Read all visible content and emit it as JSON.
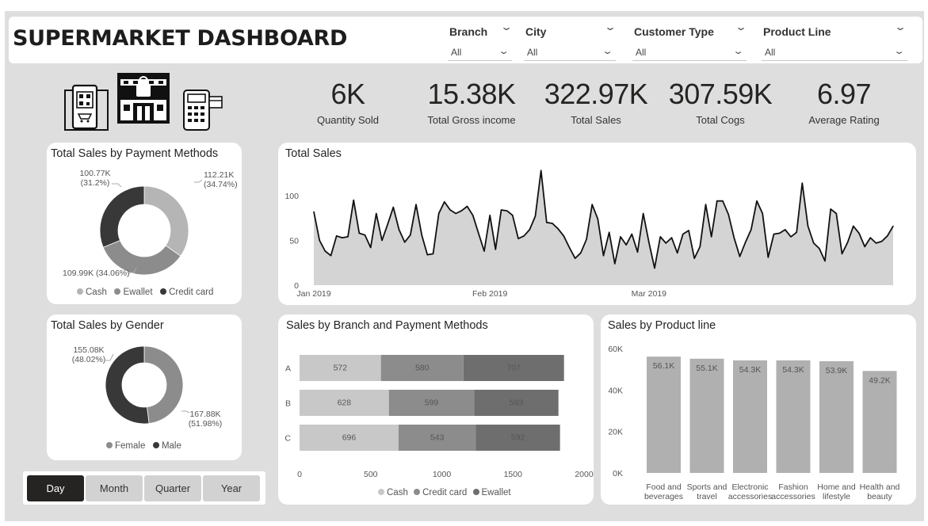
{
  "header": {
    "title": "SUPERMARKET DASHBOARD"
  },
  "filters": [
    {
      "label": "Branch",
      "value": "All"
    },
    {
      "label": "City",
      "value": "All"
    },
    {
      "label": "Customer Type",
      "value": "All"
    },
    {
      "label": "Product Line",
      "value": "All"
    }
  ],
  "kpis": [
    {
      "value": "6K",
      "label": "Quantity Sold"
    },
    {
      "value": "15.38K",
      "label": "Total Gross income"
    },
    {
      "value": "322.97K",
      "label": "Total Sales"
    },
    {
      "value": "307.59K",
      "label": "Total Cogs"
    },
    {
      "value": "6.97",
      "label": "Average Rating"
    }
  ],
  "icons": [
    "phone-qr-icon",
    "store-icon",
    "card-terminal-icon"
  ],
  "colors": {
    "light": "#b5b5b5",
    "mid": "#8c8c8c",
    "dark": "#383838",
    "area": "#d4d4d4"
  },
  "time_buttons": {
    "active": "Day",
    "items": [
      "Day",
      "Month",
      "Quarter",
      "Year"
    ]
  },
  "chart_data": [
    {
      "type": "pie",
      "title": "Total Sales by Payment Methods",
      "categories": [
        "Cash",
        "Ewallet",
        "Credit card"
      ],
      "values": [
        112.21,
        109.99,
        100.77
      ],
      "labels": [
        [
          "112.21K",
          "(34.74%)"
        ],
        [
          "109.99K (34.06%)"
        ],
        [
          "100.77K",
          "(31.2%)"
        ]
      ],
      "colors": [
        "#b5b5b5",
        "#8c8c8c",
        "#383838"
      ],
      "legend": "bottom"
    },
    {
      "type": "pie",
      "title": "Total Sales by Gender",
      "categories": [
        "Female",
        "Male"
      ],
      "values": [
        155.08,
        167.88
      ],
      "labels": [
        [
          "155.08K",
          "(48.02%)"
        ],
        [
          "167.88K",
          "(51.98%)"
        ]
      ],
      "colors": [
        "#8c8c8c",
        "#383838"
      ],
      "legend": "bottom"
    },
    {
      "type": "area",
      "title": "Total Sales",
      "x_ticks": [
        "Jan 2019",
        "Feb 2019",
        "Mar 2019"
      ],
      "y_ticks": [
        "0",
        "50",
        "100"
      ],
      "ylim": [
        0,
        130
      ],
      "x_start": "2019-01-01",
      "values": [
        82,
        50,
        38,
        33,
        55,
        53,
        54,
        95,
        58,
        56,
        42,
        80,
        50,
        68,
        87,
        62,
        48,
        56,
        90,
        56,
        34,
        35,
        80,
        93,
        84,
        80,
        83,
        88,
        78,
        58,
        38,
        78,
        40,
        84,
        83,
        78,
        52,
        55,
        62,
        77,
        128,
        70,
        69,
        63,
        55,
        42,
        30,
        36,
        51,
        90,
        74,
        33,
        59,
        24,
        54,
        45,
        57,
        37,
        80,
        48,
        19,
        54,
        47,
        53,
        36,
        57,
        61,
        30,
        43,
        90,
        54,
        94,
        94,
        79,
        53,
        32,
        48,
        62,
        94,
        80,
        31,
        57,
        58,
        62,
        54,
        59,
        114,
        66,
        47,
        41,
        27,
        85,
        80,
        35,
        48,
        66,
        58,
        43,
        53,
        47,
        49,
        55,
        66
      ],
      "grid": false
    },
    {
      "type": "bar",
      "orientation": "horizontal",
      "stacked": true,
      "title": "Sales by Branch and Payment Methods",
      "categories": [
        "A",
        "B",
        "C"
      ],
      "series": [
        {
          "name": "Cash",
          "values": [
            572,
            628,
            696
          ],
          "color": "#c8c8c8"
        },
        {
          "name": "Credit card",
          "values": [
            580,
            599,
            543
          ],
          "color": "#8c8c8c"
        },
        {
          "name": "Ewallet",
          "values": [
            707,
            593,
            592
          ],
          "color": "#6e6e6e"
        }
      ],
      "x_ticks": [
        "0",
        "500",
        "1000",
        "1500",
        "2000"
      ],
      "xlim": [
        0,
        2000
      ],
      "legend": "bottom"
    },
    {
      "type": "bar",
      "title": "Sales by Product line",
      "categories": [
        [
          "Food and",
          "beverages"
        ],
        [
          "Sports and",
          "travel"
        ],
        [
          "Electronic",
          "accessories"
        ],
        [
          "Fashion",
          "accessories"
        ],
        [
          "Home and",
          "lifestyle"
        ],
        [
          "Health and",
          "beauty"
        ]
      ],
      "values": [
        56.1,
        55.1,
        54.3,
        54.3,
        53.9,
        49.2
      ],
      "data_labels": [
        "56.1K",
        "55.1K",
        "54.3K",
        "54.3K",
        "53.9K",
        "49.2K"
      ],
      "y_ticks": [
        "0K",
        "20K",
        "40K",
        "60K"
      ],
      "ylim": [
        0,
        60
      ],
      "color": "#b0b0b0"
    }
  ]
}
